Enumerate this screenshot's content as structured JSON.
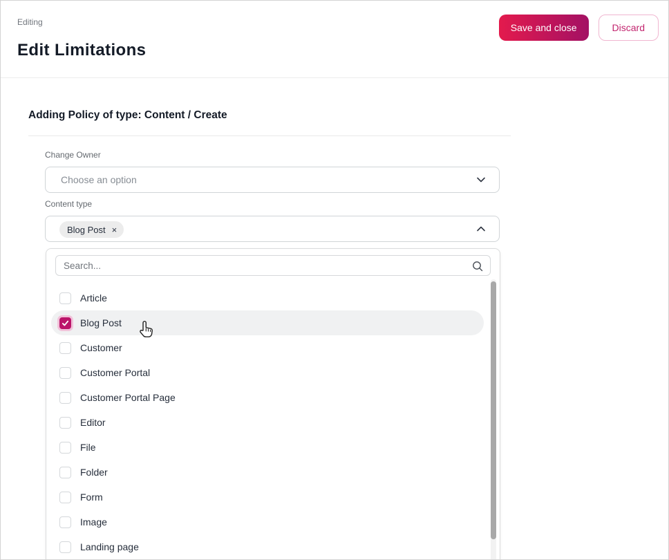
{
  "page": {
    "eyebrow": "Editing",
    "title": "Edit Limitations"
  },
  "header": {
    "save_label": "Save and close",
    "discard_label": "Discard"
  },
  "section": {
    "heading": "Adding Policy of type: Content / Create"
  },
  "form": {
    "change_owner": {
      "label": "Change Owner",
      "placeholder": "Choose an option"
    },
    "content_type": {
      "label": "Content type",
      "selected_chip": "Blog Post",
      "chip_remove_symbol": "×"
    }
  },
  "dropdown": {
    "search_placeholder": "Search...",
    "search_value": "",
    "options": [
      {
        "label": "Article",
        "checked": false,
        "highlighted": false
      },
      {
        "label": "Blog Post",
        "checked": true,
        "highlighted": true
      },
      {
        "label": "Customer",
        "checked": false,
        "highlighted": false
      },
      {
        "label": "Customer Portal",
        "checked": false,
        "highlighted": false
      },
      {
        "label": "Customer Portal Page",
        "checked": false,
        "highlighted": false
      },
      {
        "label": "Editor",
        "checked": false,
        "highlighted": false
      },
      {
        "label": "File",
        "checked": false,
        "highlighted": false
      },
      {
        "label": "Folder",
        "checked": false,
        "highlighted": false
      },
      {
        "label": "Form",
        "checked": false,
        "highlighted": false
      },
      {
        "label": "Image",
        "checked": false,
        "highlighted": false
      },
      {
        "label": "Landing page",
        "checked": false,
        "highlighted": false
      }
    ]
  },
  "colors": {
    "accent": "#bb156a",
    "save_gradient_start": "#e31a4d",
    "save_gradient_end": "#a31164",
    "discard_text": "#c2246e",
    "discard_border": "#f0b6d0",
    "row_highlight": "#f0f1f2",
    "checkbox_ring": "#f1c3da",
    "title_text": "#141b27",
    "label_text": "#63686e",
    "option_text": "#262e3b",
    "scrollbar_thumb": "#a8a8a8"
  }
}
